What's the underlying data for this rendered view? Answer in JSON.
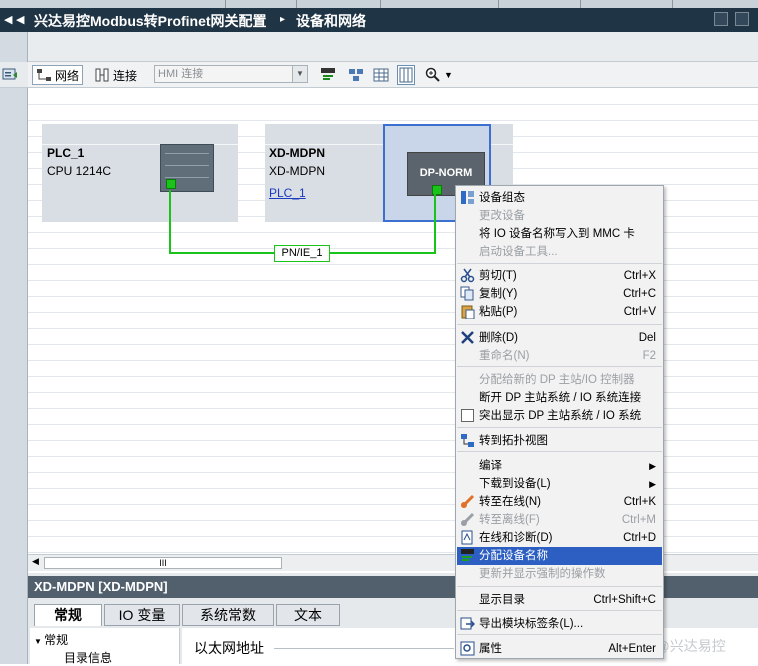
{
  "window": {
    "project_title": "兴达易控Modbus转Profinet网关配置",
    "breadcrumb_sep": "▸",
    "page_title": "设备和网络"
  },
  "toolbar": {
    "network_label": "网络",
    "connection_label": "连接",
    "hmi_select_value": "HMI 连接"
  },
  "devices": [
    {
      "name": "PLC_1",
      "type": "CPU 1214C"
    },
    {
      "name": "XD-MDPN",
      "type": "XD-MDPN",
      "link": "PLC_1",
      "module_label": "DP-NORM"
    }
  ],
  "network": {
    "label": "PN/IE_1"
  },
  "context_menu": {
    "items": [
      {
        "label": "设备组态",
        "shortcut": "",
        "disabled": false,
        "icon": "device-config-icon"
      },
      {
        "label": "更改设备",
        "shortcut": "",
        "disabled": true
      },
      {
        "label": "将 IO 设备名称写入到 MMC 卡",
        "shortcut": "",
        "disabled": false
      },
      {
        "label": "启动设备工具...",
        "shortcut": "",
        "disabled": true
      },
      {
        "label": "剪切(T)",
        "shortcut": "Ctrl+X",
        "disabled": false,
        "icon": "cut-icon"
      },
      {
        "label": "复制(Y)",
        "shortcut": "Ctrl+C",
        "disabled": false,
        "icon": "copy-icon"
      },
      {
        "label": "粘贴(P)",
        "shortcut": "Ctrl+V",
        "disabled": false,
        "icon": "paste-icon"
      },
      {
        "label": "删除(D)",
        "shortcut": "Del",
        "disabled": false,
        "icon": "delete-icon"
      },
      {
        "label": "重命名(N)",
        "shortcut": "F2",
        "disabled": true
      },
      {
        "label": "分配给新的 DP 主站/IO 控制器",
        "shortcut": "",
        "disabled": true
      },
      {
        "label": "断开 DP 主站系统 / IO 系统连接",
        "shortcut": "",
        "disabled": false
      },
      {
        "label": "突出显示 DP 主站系统 / IO 系统",
        "shortcut": "",
        "disabled": false,
        "icon": "highlight-checkbox-icon"
      },
      {
        "label": "转到拓扑视图",
        "shortcut": "",
        "disabled": false,
        "icon": "topology-icon"
      },
      {
        "label": "编译",
        "shortcut": "",
        "disabled": false,
        "submenu": true
      },
      {
        "label": "下载到设备(L)",
        "shortcut": "",
        "disabled": false,
        "submenu": true
      },
      {
        "label": "转至在线(N)",
        "shortcut": "Ctrl+K",
        "disabled": false,
        "icon": "go-online-icon"
      },
      {
        "label": "转至离线(F)",
        "shortcut": "Ctrl+M",
        "disabled": true,
        "icon": "go-offline-icon"
      },
      {
        "label": "在线和诊断(D)",
        "shortcut": "Ctrl+D",
        "disabled": false,
        "icon": "diagnostics-icon"
      },
      {
        "label": "分配设备名称",
        "shortcut": "",
        "disabled": false,
        "highlighted": true,
        "icon": "assign-name-icon"
      },
      {
        "label": "更新并显示强制的操作数",
        "shortcut": "",
        "disabled": true
      },
      {
        "label": "显示目录",
        "shortcut": "Ctrl+Shift+C",
        "disabled": false
      },
      {
        "label": "导出模块标签条(L)...",
        "shortcut": "",
        "disabled": false,
        "icon": "export-labels-icon"
      },
      {
        "label": "属性",
        "shortcut": "Alt+Enter",
        "disabled": false,
        "icon": "properties-icon"
      }
    ]
  },
  "scrollbar": {
    "grip": "III"
  },
  "bottom_panel": {
    "title": "XD-MDPN [XD-MDPN]",
    "tabs": [
      "常规",
      "IO 变量",
      "系统常数",
      "文本"
    ],
    "tree": {
      "section": "常规",
      "item": "目录信息"
    },
    "property_label": "以太网地址"
  },
  "watermark": "CSDN @兴达易控",
  "colors": {
    "title_bg": "#1f3445",
    "network_green": "#19c319",
    "highlight": "#2c5fc1",
    "device_bg": "#d9dde4"
  }
}
